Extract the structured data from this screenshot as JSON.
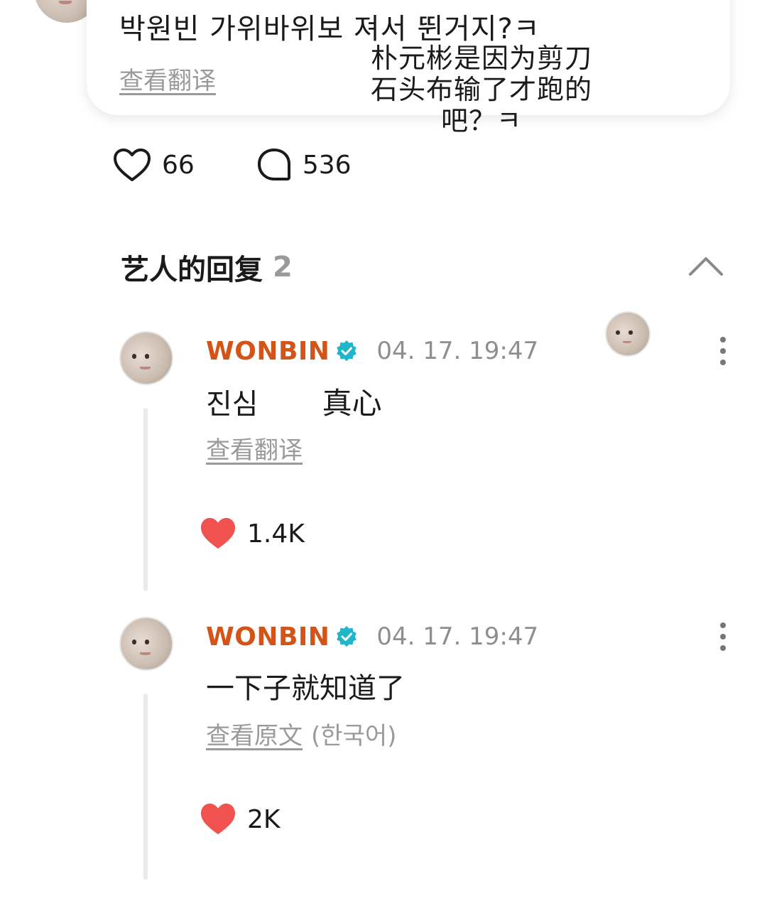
{
  "post": {
    "text": "박원빈 가위바위보 져서 뛴거지?ㅋ",
    "translate_label": "查看翻译",
    "overlay_translation": "朴元彬是因为剪刀石头布输了才跑的吧？ㅋ",
    "like_count": "66",
    "comment_count": "536"
  },
  "artist_replies": {
    "title": "艺人的回复",
    "count": "2"
  },
  "replies": [
    {
      "author": "WONBIN",
      "time": "04. 17. 19:47",
      "text": "진심",
      "overlay_translation": "真心",
      "translate_label": "查看翻译",
      "language": "",
      "like_count": "1.4K"
    },
    {
      "author": "WONBIN",
      "time": "04. 17. 19:47",
      "text": "一下子就知道了",
      "overlay_translation": "",
      "translate_label": "查看原文",
      "language": "(한국어)",
      "like_count": "2K"
    }
  ],
  "icons": {
    "like": "heart-outline-icon",
    "comment": "speech-bubble-icon",
    "liked": "heart-filled-icon",
    "verified": "verified-badge-icon",
    "more": "more-vertical-icon",
    "collapse": "chevron-up-icon"
  },
  "colors": {
    "artist_name": "#d35418",
    "verified_badge": "#1fb6c9",
    "liked_heart": "#f0524f",
    "muted_text": "#9a9a9a"
  }
}
